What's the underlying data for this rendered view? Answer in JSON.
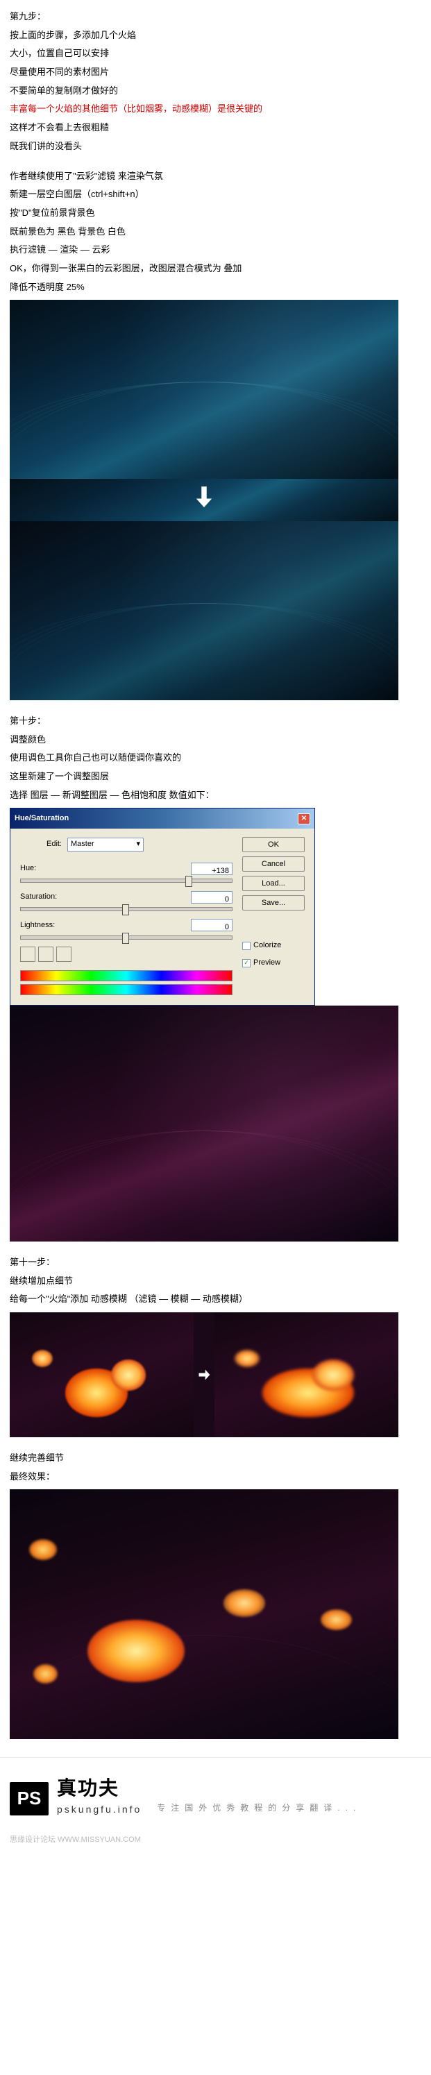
{
  "step9": {
    "heading": "第九步：",
    "line1": "按上面的步骤，多添加几个火焰",
    "line2": "大小，位置自己可以安排",
    "line3": "尽量使用不同的素材图片",
    "line4": "不要简单的复制刚才做好的",
    "line5_red": "丰富每一个火焰的其他细节（比如烟雾，动感模糊）是很关键的",
    "line6": "这样才不会看上去很粗糙",
    "line7": "既我们讲的没看头",
    "para2_l1": "作者继续使用了\"云彩\"滤镜 来渲染气氛",
    "para2_l2": "新建一层空白图层（ctrl+shift+n）",
    "para2_l3": "按\"D\"复位前景背景色",
    "para2_l4": "既前景色为 黑色  背景色 白色",
    "para2_l5": "执行滤镜 — 渲染 — 云彩",
    "para2_l6": "OK，你得到一张黑白的云彩图层，改图层混合模式为  叠加",
    "para2_l7": "降低不透明度 25%"
  },
  "step10": {
    "heading": "第十步：",
    "line1": "调整颜色",
    "line2": "使用调色工具你自己也可以随便调你喜欢的",
    "line3": "这里新建了一个调整图层",
    "line4": "选择 图层 — 新调整图层 — 色相饱和度   数值如下："
  },
  "hs_dialog": {
    "title": "Hue/Saturation",
    "edit_label": "Edit:",
    "edit_value": "Master",
    "hue_label": "Hue:",
    "hue_value": "+138",
    "sat_label": "Saturation:",
    "sat_value": "0",
    "light_label": "Lightness:",
    "light_value": "0",
    "ok": "OK",
    "cancel": "Cancel",
    "load": "Load...",
    "save": "Save...",
    "colorize": "Colorize",
    "preview": "Preview"
  },
  "step11": {
    "heading": "第十一步：",
    "line1": "继续增加点细节",
    "line2": "给每一个\"火焰\"添加 动感模糊 （滤镜 — 模糊 — 动感模糊）"
  },
  "finish": {
    "line1": "继续完善细节",
    "line2": "最终效果："
  },
  "footer": {
    "logo": "PS",
    "brand_cn": "真功夫",
    "brand_url": "pskungfu.info",
    "slogan": "专注国外优秀教程的分享翻译...",
    "sub": "思缘设计论坛   WWW.MISSYUAN.COM"
  },
  "chart_data": {
    "type": "table",
    "title": "Hue/Saturation adjustment values",
    "rows": [
      {
        "parameter": "Hue",
        "value": 138
      },
      {
        "parameter": "Saturation",
        "value": 0
      },
      {
        "parameter": "Lightness",
        "value": 0
      }
    ],
    "colorize": false,
    "preview": true,
    "opacity_note_percent": 25
  }
}
